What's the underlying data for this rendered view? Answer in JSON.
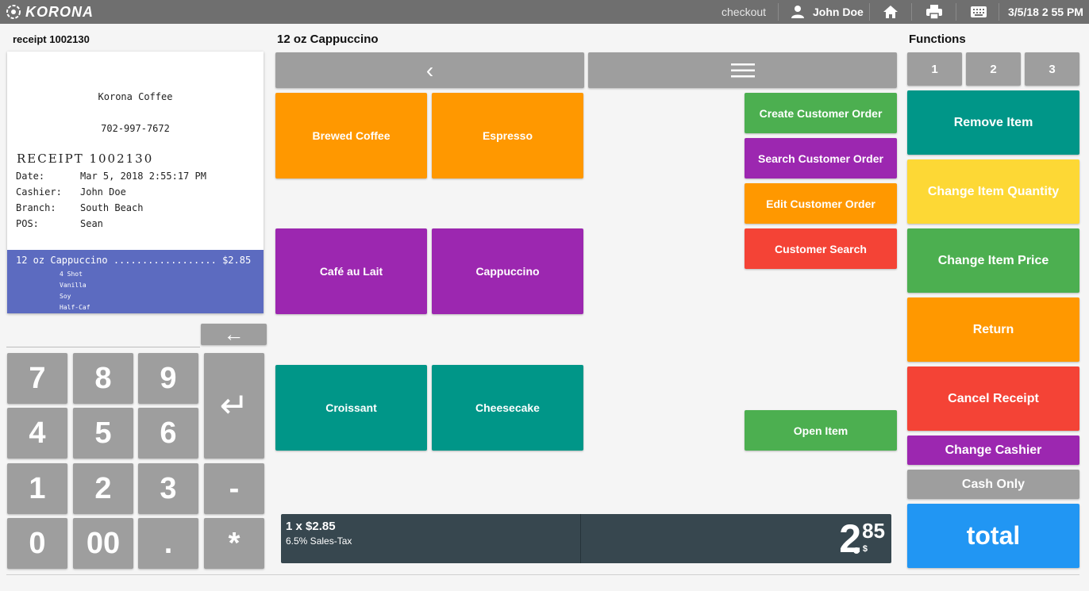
{
  "app": {
    "logo_text": "KORONA"
  },
  "topbar": {
    "mode": "checkout",
    "user": "John Doe",
    "datetime": "3/5/18 2 55 PM",
    "icons": [
      "user-icon",
      "home-icon",
      "printer-icon",
      "keyboard-icon"
    ]
  },
  "receipt_panel": {
    "heading": "receipt 1002130",
    "store_name": "Korona Coffee",
    "phone": "702-997-7672",
    "title": "RECEIPT 1002130",
    "fields": [
      {
        "key": "Date:",
        "value": "Mar 5, 2018 2:55:17 PM"
      },
      {
        "key": "Cashier:",
        "value": "John Doe"
      },
      {
        "key": "Branch:",
        "value": "South Beach"
      },
      {
        "key": "POS:",
        "value": "Sean"
      }
    ],
    "selected_line": "12 oz Cappuccino .................. $2.85",
    "modifiers": [
      "4 Shot",
      "Vanilla",
      "Soy",
      "Half-Caf"
    ]
  },
  "keypad": {
    "backspace_glyph": "←",
    "enter_glyph": "↵",
    "keys": [
      "7",
      "8",
      "9",
      "4",
      "5",
      "6",
      "1",
      "2",
      "3",
      "-",
      "0",
      "00",
      ".",
      "*"
    ]
  },
  "product_panel": {
    "heading": "12 oz Cappuccino",
    "back_glyph": "‹",
    "products": [
      "Brewed Coffee",
      "Espresso",
      "Café au Lait",
      "Cappuccino",
      "Croissant",
      "Cheesecake"
    ],
    "actions": [
      "Create Customer Order",
      "Search Customer Order",
      "Edit Customer Order",
      "Customer Search"
    ],
    "open_item": "Open Item"
  },
  "total_bar": {
    "qty_price": "1 x $2.85",
    "tax": "6.5% Sales-Tax",
    "amount_whole": "2",
    "amount_cents": "85",
    "currency": "$"
  },
  "functions": {
    "heading": "Functions",
    "pages": [
      "1",
      "2",
      "3"
    ],
    "buttons": [
      "Remove Item",
      "Change Item Quantity",
      "Change Item Price",
      "Return",
      "Cancel Receipt",
      "Change Cashier",
      "Cash Only"
    ],
    "total": "total"
  },
  "colors": {
    "orange": "#ff9800",
    "purple": "#9c27b0",
    "teal": "#009688",
    "green": "#4caf50",
    "red": "#f44336",
    "yellow": "#fdd835",
    "blue": "#2196f3",
    "gray": "#9e9e9e",
    "receipt_highlight": "#5c6bc0",
    "total_bar": "#37474f"
  }
}
